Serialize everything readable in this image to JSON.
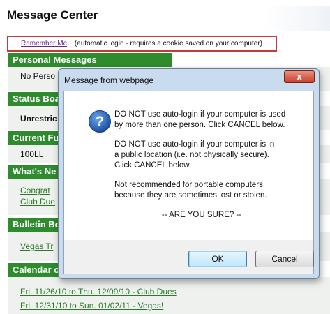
{
  "page": {
    "title": "Message Center",
    "remember_me": {
      "link": "Remember Me",
      "note": "(automatic login - requires a cookie saved on your computer)"
    }
  },
  "sections": {
    "personal_messages": {
      "header": "Personal Messages",
      "text": "No Perso"
    },
    "status_board": {
      "header": "Status Boa",
      "text": "Unrestric"
    },
    "current_fuel": {
      "header": "Current Fu",
      "text": "100LL"
    },
    "whats_new": {
      "header": "What's Ne",
      "links": [
        "Congrat",
        "Club Due"
      ]
    },
    "bulletin_board": {
      "header": "Bulletin Bo",
      "links": [
        "Vegas Tr"
      ]
    },
    "calendar": {
      "header": "Calendar o",
      "links": [
        "Fri. 11/26/10 to Thu. 12/09/10 - Club Dues",
        "Fri. 12/31/10 to Sun. 01/02/11 - Vegas!"
      ]
    }
  },
  "dialog": {
    "title": "Message from webpage",
    "close_label": "x",
    "icon": "question-icon",
    "paragraphs": [
      "DO NOT use auto-login if your computer is used\nby more than one person.  Click CANCEL below.",
      "DO NOT use auto-login if your computer is in\na public location (i.e. not physically secure).\nClick CANCEL below.",
      "Not recommended for portable computers\nbecause they are sometimes lost or stolen.",
      "-- ARE YOU SURE? --"
    ],
    "ok_label": "OK",
    "cancel_label": "Cancel"
  },
  "colors": {
    "section_header_bg": "#2e8b2e",
    "link": "#2a7a2a",
    "remember_border": "#c23a3a"
  }
}
